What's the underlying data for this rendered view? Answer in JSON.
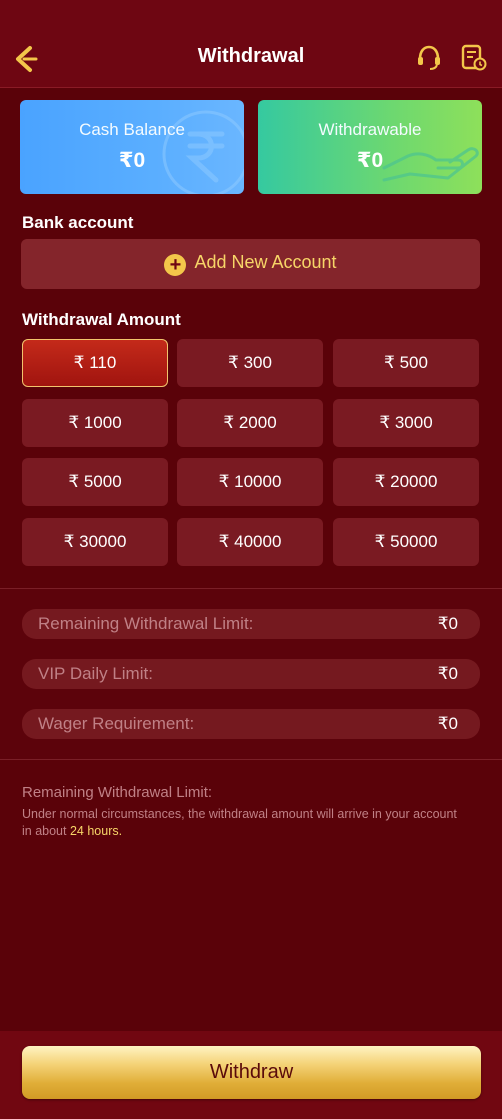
{
  "header": {
    "title": "Withdrawal",
    "back_icon": "back-arrow-icon",
    "support_icon": "headset-icon",
    "records_icon": "records-icon"
  },
  "cards": {
    "cash": {
      "label": "Cash Balance",
      "value": "₹0",
      "icon": "rupee-icon"
    },
    "withdrawable": {
      "label": "Withdrawable",
      "value": "₹0",
      "icon": "hand-icon"
    }
  },
  "bank": {
    "title": "Bank account",
    "add_label": "Add New Account"
  },
  "amount": {
    "title": "Withdrawal Amount",
    "selected": "₹ 110",
    "options": [
      "₹ 110",
      "₹ 300",
      "₹ 500",
      "₹ 1000",
      "₹ 2000",
      "₹ 3000",
      "₹ 5000",
      "₹ 10000",
      "₹ 20000",
      "₹ 30000",
      "₹ 40000",
      "₹ 50000"
    ]
  },
  "limits": [
    {
      "label": "Remaining Withdrawal Limit:",
      "value": "₹0"
    },
    {
      "label": "VIP Daily Limit:",
      "value": "₹0"
    },
    {
      "label": "Wager Requirement:",
      "value": "₹0"
    }
  ],
  "notice": {
    "title": "Remaining Withdrawal Limit:",
    "text_before": "Under normal circumstances, the withdrawal amount will arrive in your account in about ",
    "highlight": "24 hours."
  },
  "footer": {
    "button_label": "Withdraw"
  },
  "colors": {
    "background": "#5a0209",
    "accent_gold": "#f7d568",
    "selected_red": "#c42a1a"
  }
}
